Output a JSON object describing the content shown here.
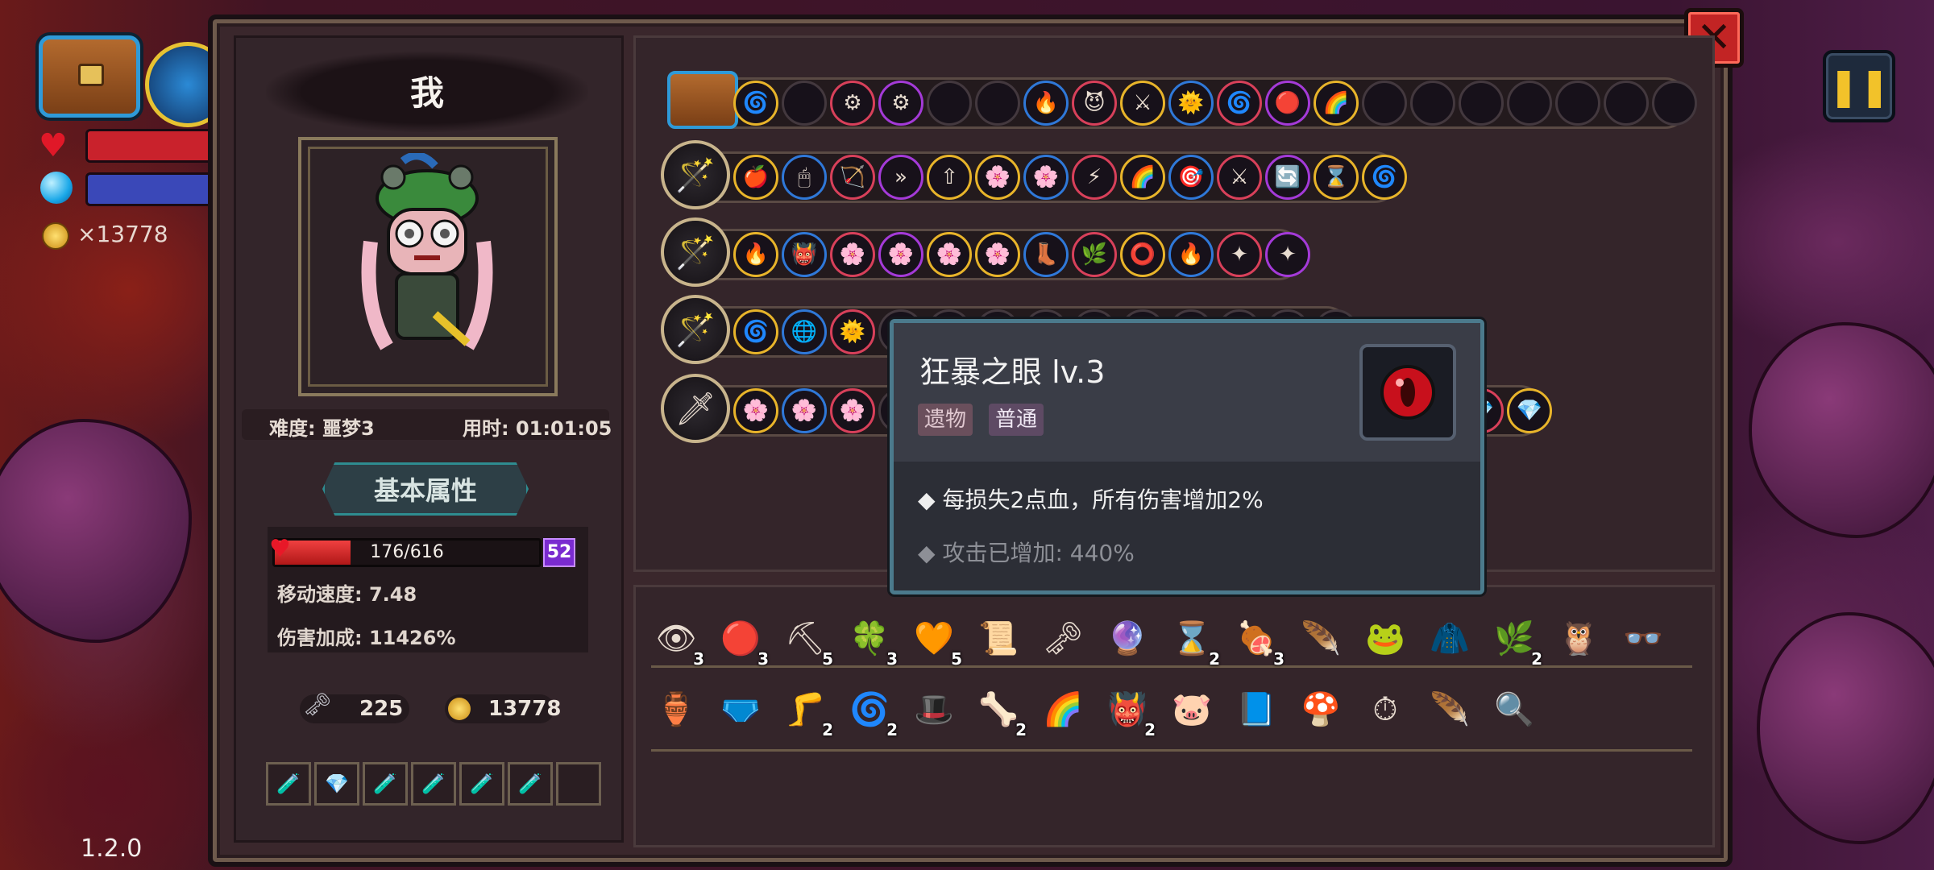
{
  "hud": {
    "gold": "×13778",
    "version": "1.2.0",
    "pause_icon": "pause-icon",
    "colors": {
      "hp": "#e01828",
      "mana": "#3a48b8"
    }
  },
  "profile": {
    "name": "我",
    "difficulty": "难度: 噩梦3",
    "time": "用时: 01:01:05",
    "tab_label": "基本属性",
    "hp": {
      "text": "176/616",
      "current": 176,
      "max": 616
    },
    "level": "52",
    "move_speed": "移动速度: 7.48",
    "damage_bonus": "伤害加成: 11426%",
    "keys": "225",
    "coins": "13778"
  },
  "potions": [
    "🧪",
    "💎",
    "🧪",
    "🧪",
    "🧪",
    "🧪",
    ""
  ],
  "tooltip": {
    "title": "狂暴之眼 lv.3",
    "tags": [
      "遗物",
      "普通"
    ],
    "description": "每损失2点血，所有伤害增加2%",
    "bonus": "攻击已增加: 440%",
    "colors": {
      "tag_relic": "#6a4f5c",
      "tag_common": "#5e4a64"
    }
  },
  "weapon_rows": [
    {
      "main_icon": "chest-icon",
      "slots": [
        "🌀",
        "",
        "⚙",
        "⚙",
        "",
        "",
        "🔥",
        "😈",
        "⚔",
        "🌞",
        "🌀",
        "🔴",
        "🌈",
        "",
        "",
        "",
        "",
        "",
        "",
        ""
      ]
    },
    {
      "main_icon": "🪄",
      "slots": [
        "🍎",
        "🖱",
        "🏹",
        "»",
        "⇧",
        "🌸",
        "🌸",
        "⚡",
        "🌈",
        "🎯",
        "⚔",
        "🔄",
        "⌛",
        "🌀"
      ]
    },
    {
      "main_icon": "🪄",
      "slots": [
        "🔥",
        "👹",
        "🌸",
        "🌸",
        "🌸",
        "🌸",
        "👢",
        "🌿",
        "⭕",
        "🔥",
        "✦",
        "✦"
      ]
    },
    {
      "main_icon": "🪄",
      "slots": [
        "🌀",
        "🌐",
        "🌞",
        "",
        "",
        "",
        "",
        "",
        "",
        "",
        "",
        "",
        ""
      ]
    },
    {
      "main_icon": "🗡",
      "slots": [
        "🌸",
        "🌸",
        "🌸",
        "",
        "",
        "",
        "",
        "",
        "",
        "",
        "",
        "",
        "",
        "",
        "",
        "💎",
        "💎"
      ]
    }
  ],
  "relics_row1": [
    {
      "icon": "👁",
      "count": "3"
    },
    {
      "icon": "🔴",
      "count": "3"
    },
    {
      "icon": "⛏",
      "count": "5"
    },
    {
      "icon": "🍀",
      "count": "3"
    },
    {
      "icon": "🧡",
      "count": "5"
    },
    {
      "icon": "📜",
      "count": ""
    },
    {
      "icon": "🗝",
      "count": ""
    },
    {
      "icon": "🔮",
      "count": ""
    },
    {
      "icon": "⌛",
      "count": "2"
    },
    {
      "icon": "🍖",
      "count": "3"
    },
    {
      "icon": "🪶",
      "count": ""
    },
    {
      "icon": "🐸",
      "count": ""
    },
    {
      "icon": "🧥",
      "count": ""
    },
    {
      "icon": "🌿",
      "count": "2"
    },
    {
      "icon": "🦉",
      "count": ""
    },
    {
      "icon": "👓",
      "count": ""
    }
  ],
  "relics_row2": [
    {
      "icon": "🏺",
      "count": ""
    },
    {
      "icon": "🩲",
      "count": ""
    },
    {
      "icon": "🦵",
      "count": "2"
    },
    {
      "icon": "🌀",
      "count": "2"
    },
    {
      "icon": "🎩",
      "count": ""
    },
    {
      "icon": "🦴",
      "count": "2"
    },
    {
      "icon": "🌈",
      "count": ""
    },
    {
      "icon": "👹",
      "count": "2"
    },
    {
      "icon": "🐷",
      "count": ""
    },
    {
      "icon": "📘",
      "count": ""
    },
    {
      "icon": "🍄",
      "count": ""
    },
    {
      "icon": "⏱",
      "count": ""
    },
    {
      "icon": "🪶",
      "count": ""
    },
    {
      "icon": "🔍",
      "count": ""
    }
  ]
}
